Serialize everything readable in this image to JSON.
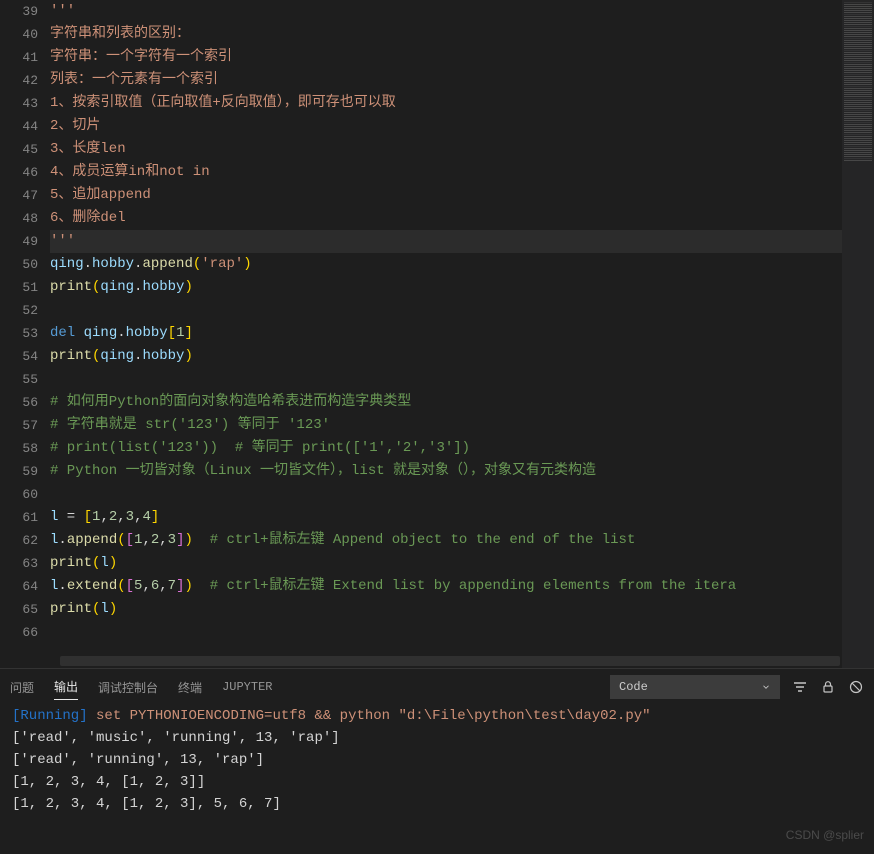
{
  "code_lines": [
    {
      "num": 39,
      "tokens": [
        {
          "t": "'''",
          "cls": "s"
        }
      ]
    },
    {
      "num": 40,
      "tokens": [
        {
          "t": "字符串和列表的区别：",
          "cls": "s"
        }
      ]
    },
    {
      "num": 41,
      "tokens": [
        {
          "t": "字符串：一个字符有一个索引",
          "cls": "s"
        }
      ]
    },
    {
      "num": 42,
      "tokens": [
        {
          "t": "列表：一个元素有一个索引",
          "cls": "s"
        }
      ]
    },
    {
      "num": 43,
      "tokens": [
        {
          "t": "1、按索引取值（正向取值+反向取值），即可存也可以取",
          "cls": "s"
        }
      ]
    },
    {
      "num": 44,
      "tokens": [
        {
          "t": "2、切片",
          "cls": "s"
        }
      ]
    },
    {
      "num": 45,
      "tokens": [
        {
          "t": "3、长度len",
          "cls": "s"
        }
      ]
    },
    {
      "num": 46,
      "tokens": [
        {
          "t": "4、成员运算in和not in",
          "cls": "s"
        }
      ]
    },
    {
      "num": 47,
      "tokens": [
        {
          "t": "5、追加append",
          "cls": "s"
        }
      ]
    },
    {
      "num": 48,
      "tokens": [
        {
          "t": "6、删除del",
          "cls": "s"
        }
      ]
    },
    {
      "num": 49,
      "highlight": true,
      "tokens": [
        {
          "t": "'''",
          "cls": "s"
        }
      ]
    },
    {
      "num": 50,
      "tokens": [
        {
          "t": "qing",
          "cls": "v"
        },
        {
          "t": ".",
          "cls": "p"
        },
        {
          "t": "hobby",
          "cls": "v"
        },
        {
          "t": ".",
          "cls": "p"
        },
        {
          "t": "append",
          "cls": "fn"
        },
        {
          "t": "(",
          "cls": "br"
        },
        {
          "t": "'rap'",
          "cls": "s"
        },
        {
          "t": ")",
          "cls": "br"
        }
      ]
    },
    {
      "num": 51,
      "tokens": [
        {
          "t": "print",
          "cls": "fn"
        },
        {
          "t": "(",
          "cls": "br"
        },
        {
          "t": "qing",
          "cls": "v"
        },
        {
          "t": ".",
          "cls": "p"
        },
        {
          "t": "hobby",
          "cls": "v"
        },
        {
          "t": ")",
          "cls": "br"
        }
      ]
    },
    {
      "num": 52,
      "tokens": [
        {
          "t": " ",
          "cls": "p"
        }
      ]
    },
    {
      "num": 53,
      "tokens": [
        {
          "t": "del",
          "cls": "k2"
        },
        {
          "t": " ",
          "cls": "p"
        },
        {
          "t": "qing",
          "cls": "v"
        },
        {
          "t": ".",
          "cls": "p"
        },
        {
          "t": "hobby",
          "cls": "v"
        },
        {
          "t": "[",
          "cls": "br"
        },
        {
          "t": "1",
          "cls": "n"
        },
        {
          "t": "]",
          "cls": "br"
        }
      ]
    },
    {
      "num": 54,
      "tokens": [
        {
          "t": "print",
          "cls": "fn"
        },
        {
          "t": "(",
          "cls": "br"
        },
        {
          "t": "qing",
          "cls": "v"
        },
        {
          "t": ".",
          "cls": "p"
        },
        {
          "t": "hobby",
          "cls": "v"
        },
        {
          "t": ")",
          "cls": "br"
        }
      ]
    },
    {
      "num": 55,
      "tokens": [
        {
          "t": " ",
          "cls": "p"
        }
      ]
    },
    {
      "num": 56,
      "tokens": [
        {
          "t": "# 如何用Python的面向对象构造哈希表进而构造字典类型",
          "cls": "c"
        }
      ]
    },
    {
      "num": 57,
      "tokens": [
        {
          "t": "# 字符串就是 str('123') 等同于 '123'",
          "cls": "c"
        }
      ]
    },
    {
      "num": 58,
      "tokens": [
        {
          "t": "# print(list('123'))  # 等同于 print(['1','2','3'])",
          "cls": "c"
        }
      ]
    },
    {
      "num": 59,
      "tokens": [
        {
          "t": "# Python 一切皆对象（Linux 一切皆文件），list 就是对象（），对象又有元类构造",
          "cls": "c"
        }
      ]
    },
    {
      "num": 60,
      "tokens": [
        {
          "t": " ",
          "cls": "p"
        }
      ]
    },
    {
      "num": 61,
      "tokens": [
        {
          "t": "l",
          "cls": "v"
        },
        {
          "t": " = ",
          "cls": "op"
        },
        {
          "t": "[",
          "cls": "br"
        },
        {
          "t": "1",
          "cls": "n"
        },
        {
          "t": ",",
          "cls": "p"
        },
        {
          "t": "2",
          "cls": "n"
        },
        {
          "t": ",",
          "cls": "p"
        },
        {
          "t": "3",
          "cls": "n"
        },
        {
          "t": ",",
          "cls": "p"
        },
        {
          "t": "4",
          "cls": "n"
        },
        {
          "t": "]",
          "cls": "br"
        }
      ]
    },
    {
      "num": 62,
      "tokens": [
        {
          "t": "l",
          "cls": "v"
        },
        {
          "t": ".",
          "cls": "p"
        },
        {
          "t": "append",
          "cls": "fn"
        },
        {
          "t": "(",
          "cls": "br"
        },
        {
          "t": "[",
          "cls": "br2"
        },
        {
          "t": "1",
          "cls": "n"
        },
        {
          "t": ",",
          "cls": "p"
        },
        {
          "t": "2",
          "cls": "n"
        },
        {
          "t": ",",
          "cls": "p"
        },
        {
          "t": "3",
          "cls": "n"
        },
        {
          "t": "]",
          "cls": "br2"
        },
        {
          "t": ")",
          "cls": "br"
        },
        {
          "t": "  ",
          "cls": "p"
        },
        {
          "t": "# ctrl+鼠标左键 Append object to the end of the list",
          "cls": "c"
        }
      ]
    },
    {
      "num": 63,
      "tokens": [
        {
          "t": "print",
          "cls": "fn"
        },
        {
          "t": "(",
          "cls": "br"
        },
        {
          "t": "l",
          "cls": "v"
        },
        {
          "t": ")",
          "cls": "br"
        }
      ]
    },
    {
      "num": 64,
      "tokens": [
        {
          "t": "l",
          "cls": "v"
        },
        {
          "t": ".",
          "cls": "p"
        },
        {
          "t": "extend",
          "cls": "fn"
        },
        {
          "t": "(",
          "cls": "br"
        },
        {
          "t": "[",
          "cls": "br2"
        },
        {
          "t": "5",
          "cls": "n"
        },
        {
          "t": ",",
          "cls": "p"
        },
        {
          "t": "6",
          "cls": "n"
        },
        {
          "t": ",",
          "cls": "p"
        },
        {
          "t": "7",
          "cls": "n"
        },
        {
          "t": "]",
          "cls": "br2"
        },
        {
          "t": ")",
          "cls": "br"
        },
        {
          "t": "  ",
          "cls": "p"
        },
        {
          "t": "# ctrl+鼠标左键 Extend list by appending elements from the itera",
          "cls": "c"
        }
      ]
    },
    {
      "num": 65,
      "tokens": [
        {
          "t": "print",
          "cls": "fn"
        },
        {
          "t": "(",
          "cls": "br"
        },
        {
          "t": "l",
          "cls": "v"
        },
        {
          "t": ")",
          "cls": "br"
        }
      ]
    },
    {
      "num": 66,
      "tokens": [
        {
          "t": " ",
          "cls": "p"
        }
      ]
    }
  ],
  "panel": {
    "tabs": {
      "problems": "问题",
      "output": "输出",
      "debug_console": "调试控制台",
      "terminal": "终端",
      "jupyter": "JUPYTER"
    },
    "select_value": "Code"
  },
  "terminal_output": {
    "run_prefix": "[Running]",
    "run_cmd_plain": " set PYTHONIOENCODING=utf8 && python ",
    "run_path": "\"d:\\File\\python\\test\\day02.py\"",
    "lines": [
      "['read', 'music', 'running', 13, 'rap']",
      "['read', 'running', 13, 'rap']",
      "[1, 2, 3, 4, [1, 2, 3]]",
      "[1, 2, 3, 4, [1, 2, 3], 5, 6, 7]"
    ]
  },
  "watermark": "CSDN @splier"
}
